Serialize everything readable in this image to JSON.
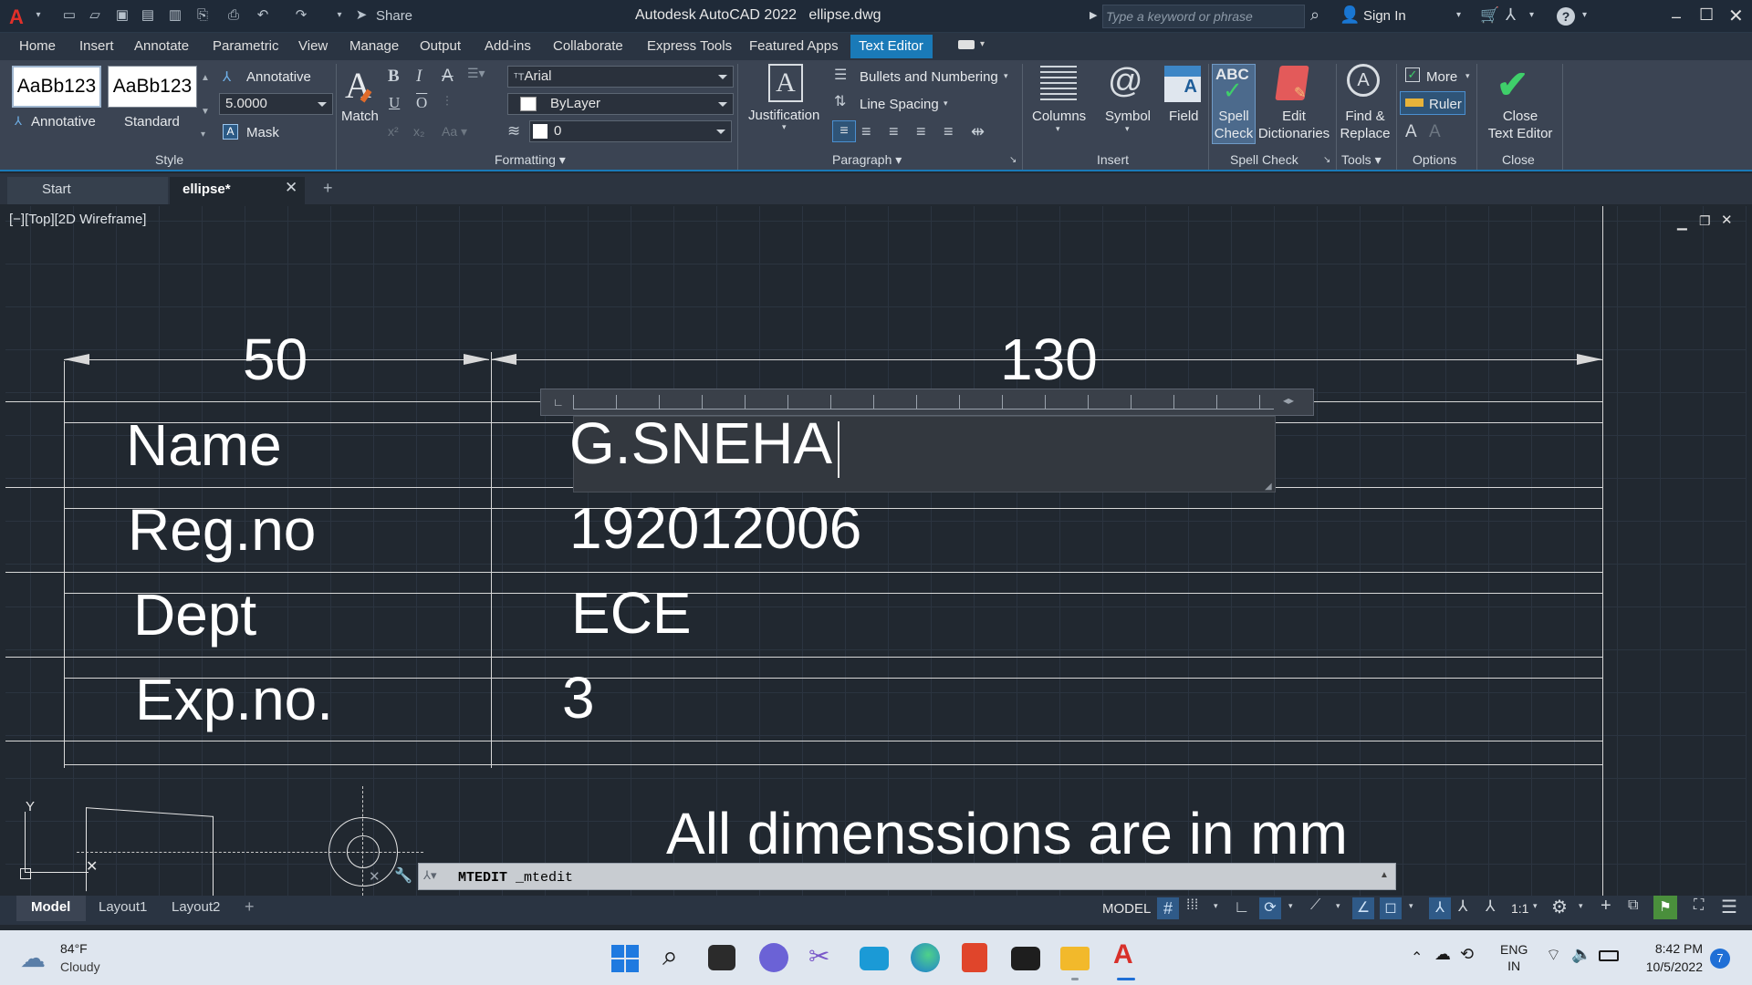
{
  "window": {
    "app_title": "Autodesk AutoCAD 2022",
    "file_name": "ellipse.dwg",
    "share_label": "Share",
    "search_placeholder": "Type a keyword or phrase",
    "sign_in": "Sign In"
  },
  "ribbon_tabs": [
    "Home",
    "Insert",
    "Annotate",
    "Parametric",
    "View",
    "Manage",
    "Output",
    "Add-ins",
    "Collaborate",
    "Express Tools",
    "Featured Apps",
    "Text Editor"
  ],
  "active_ribbon_tab": "Text Editor",
  "style_panel": {
    "style1_sample": "AaBb123",
    "style1_name": "Annotative",
    "style2_sample": "AaBb123",
    "style2_name": "Standard",
    "annotative_label": "Annotative",
    "text_height": "5.0000",
    "mask_label": "Mask",
    "title": "Style"
  },
  "formatting_panel": {
    "match_label": "Match",
    "font": "Arial",
    "color": "ByLayer",
    "oblique": "0",
    "title": "Formatting"
  },
  "paragraph_panel": {
    "justification": "Justification",
    "bullets": "Bullets and Numbering",
    "line_spacing": "Line Spacing",
    "title": "Paragraph"
  },
  "insert_panel": {
    "columns": "Columns",
    "symbol": "Symbol",
    "field": "Field",
    "title": "Insert"
  },
  "spell_panel": {
    "spell_icon_text": "ABC",
    "spell_line1": "Spell",
    "spell_line2": "Check",
    "edit_line1": "Edit",
    "edit_line2": "Dictionaries",
    "title": "Spell Check"
  },
  "tools_panel": {
    "find_line1": "Find &",
    "find_line2": "Replace",
    "title": "Tools"
  },
  "options_panel": {
    "more": "More",
    "ruler": "Ruler",
    "title": "Options"
  },
  "close_panel": {
    "close_line1": "Close",
    "close_line2": "Text Editor",
    "title": "Close"
  },
  "doc_tabs": [
    "Start",
    "ellipse*"
  ],
  "viewport_label": "[−][Top][2D Wireframe]",
  "drawing": {
    "dim_left": "50",
    "dim_right": "130",
    "rows": [
      {
        "label": "Name",
        "value": "G.SNEHA"
      },
      {
        "label": "Reg.no",
        "value": "192012006"
      },
      {
        "label": "Dept",
        "value": "ECE"
      },
      {
        "label": "Exp.no.",
        "value": "3"
      }
    ],
    "note": "All dimenssions are in mm",
    "ucs_y": "Y"
  },
  "command_line": {
    "command": "MTEDIT",
    "echo": "_mtedit"
  },
  "layout_tabs": [
    "Model",
    "Layout1",
    "Layout2"
  ],
  "status": {
    "model": "MODEL",
    "scale": "1:1"
  },
  "taskbar": {
    "temp": "84°F",
    "weather": "Cloudy",
    "lang1": "ENG",
    "lang2": "IN",
    "time": "8:42 PM",
    "date": "10/5/2022",
    "notif": "7"
  }
}
